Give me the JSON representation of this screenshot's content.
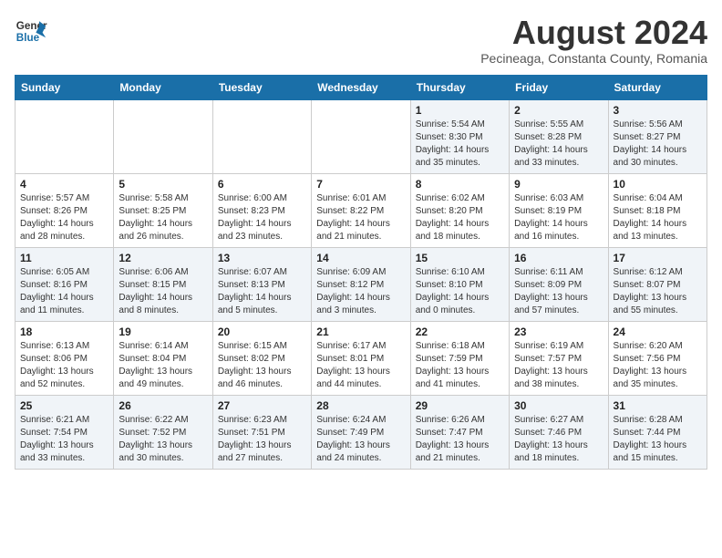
{
  "logo": {
    "line1": "General",
    "line2": "Blue"
  },
  "title": "August 2024",
  "subtitle": "Pecineaga, Constanta County, Romania",
  "weekdays": [
    "Sunday",
    "Monday",
    "Tuesday",
    "Wednesday",
    "Thursday",
    "Friday",
    "Saturday"
  ],
  "weeks": [
    [
      {
        "day": "",
        "info": ""
      },
      {
        "day": "",
        "info": ""
      },
      {
        "day": "",
        "info": ""
      },
      {
        "day": "",
        "info": ""
      },
      {
        "day": "1",
        "info": "Sunrise: 5:54 AM\nSunset: 8:30 PM\nDaylight: 14 hours\nand 35 minutes."
      },
      {
        "day": "2",
        "info": "Sunrise: 5:55 AM\nSunset: 8:28 PM\nDaylight: 14 hours\nand 33 minutes."
      },
      {
        "day": "3",
        "info": "Sunrise: 5:56 AM\nSunset: 8:27 PM\nDaylight: 14 hours\nand 30 minutes."
      }
    ],
    [
      {
        "day": "4",
        "info": "Sunrise: 5:57 AM\nSunset: 8:26 PM\nDaylight: 14 hours\nand 28 minutes."
      },
      {
        "day": "5",
        "info": "Sunrise: 5:58 AM\nSunset: 8:25 PM\nDaylight: 14 hours\nand 26 minutes."
      },
      {
        "day": "6",
        "info": "Sunrise: 6:00 AM\nSunset: 8:23 PM\nDaylight: 14 hours\nand 23 minutes."
      },
      {
        "day": "7",
        "info": "Sunrise: 6:01 AM\nSunset: 8:22 PM\nDaylight: 14 hours\nand 21 minutes."
      },
      {
        "day": "8",
        "info": "Sunrise: 6:02 AM\nSunset: 8:20 PM\nDaylight: 14 hours\nand 18 minutes."
      },
      {
        "day": "9",
        "info": "Sunrise: 6:03 AM\nSunset: 8:19 PM\nDaylight: 14 hours\nand 16 minutes."
      },
      {
        "day": "10",
        "info": "Sunrise: 6:04 AM\nSunset: 8:18 PM\nDaylight: 14 hours\nand 13 minutes."
      }
    ],
    [
      {
        "day": "11",
        "info": "Sunrise: 6:05 AM\nSunset: 8:16 PM\nDaylight: 14 hours\nand 11 minutes."
      },
      {
        "day": "12",
        "info": "Sunrise: 6:06 AM\nSunset: 8:15 PM\nDaylight: 14 hours\nand 8 minutes."
      },
      {
        "day": "13",
        "info": "Sunrise: 6:07 AM\nSunset: 8:13 PM\nDaylight: 14 hours\nand 5 minutes."
      },
      {
        "day": "14",
        "info": "Sunrise: 6:09 AM\nSunset: 8:12 PM\nDaylight: 14 hours\nand 3 minutes."
      },
      {
        "day": "15",
        "info": "Sunrise: 6:10 AM\nSunset: 8:10 PM\nDaylight: 14 hours\nand 0 minutes."
      },
      {
        "day": "16",
        "info": "Sunrise: 6:11 AM\nSunset: 8:09 PM\nDaylight: 13 hours\nand 57 minutes."
      },
      {
        "day": "17",
        "info": "Sunrise: 6:12 AM\nSunset: 8:07 PM\nDaylight: 13 hours\nand 55 minutes."
      }
    ],
    [
      {
        "day": "18",
        "info": "Sunrise: 6:13 AM\nSunset: 8:06 PM\nDaylight: 13 hours\nand 52 minutes."
      },
      {
        "day": "19",
        "info": "Sunrise: 6:14 AM\nSunset: 8:04 PM\nDaylight: 13 hours\nand 49 minutes."
      },
      {
        "day": "20",
        "info": "Sunrise: 6:15 AM\nSunset: 8:02 PM\nDaylight: 13 hours\nand 46 minutes."
      },
      {
        "day": "21",
        "info": "Sunrise: 6:17 AM\nSunset: 8:01 PM\nDaylight: 13 hours\nand 44 minutes."
      },
      {
        "day": "22",
        "info": "Sunrise: 6:18 AM\nSunset: 7:59 PM\nDaylight: 13 hours\nand 41 minutes."
      },
      {
        "day": "23",
        "info": "Sunrise: 6:19 AM\nSunset: 7:57 PM\nDaylight: 13 hours\nand 38 minutes."
      },
      {
        "day": "24",
        "info": "Sunrise: 6:20 AM\nSunset: 7:56 PM\nDaylight: 13 hours\nand 35 minutes."
      }
    ],
    [
      {
        "day": "25",
        "info": "Sunrise: 6:21 AM\nSunset: 7:54 PM\nDaylight: 13 hours\nand 33 minutes."
      },
      {
        "day": "26",
        "info": "Sunrise: 6:22 AM\nSunset: 7:52 PM\nDaylight: 13 hours\nand 30 minutes."
      },
      {
        "day": "27",
        "info": "Sunrise: 6:23 AM\nSunset: 7:51 PM\nDaylight: 13 hours\nand 27 minutes."
      },
      {
        "day": "28",
        "info": "Sunrise: 6:24 AM\nSunset: 7:49 PM\nDaylight: 13 hours\nand 24 minutes."
      },
      {
        "day": "29",
        "info": "Sunrise: 6:26 AM\nSunset: 7:47 PM\nDaylight: 13 hours\nand 21 minutes."
      },
      {
        "day": "30",
        "info": "Sunrise: 6:27 AM\nSunset: 7:46 PM\nDaylight: 13 hours\nand 18 minutes."
      },
      {
        "day": "31",
        "info": "Sunrise: 6:28 AM\nSunset: 7:44 PM\nDaylight: 13 hours\nand 15 minutes."
      }
    ]
  ]
}
